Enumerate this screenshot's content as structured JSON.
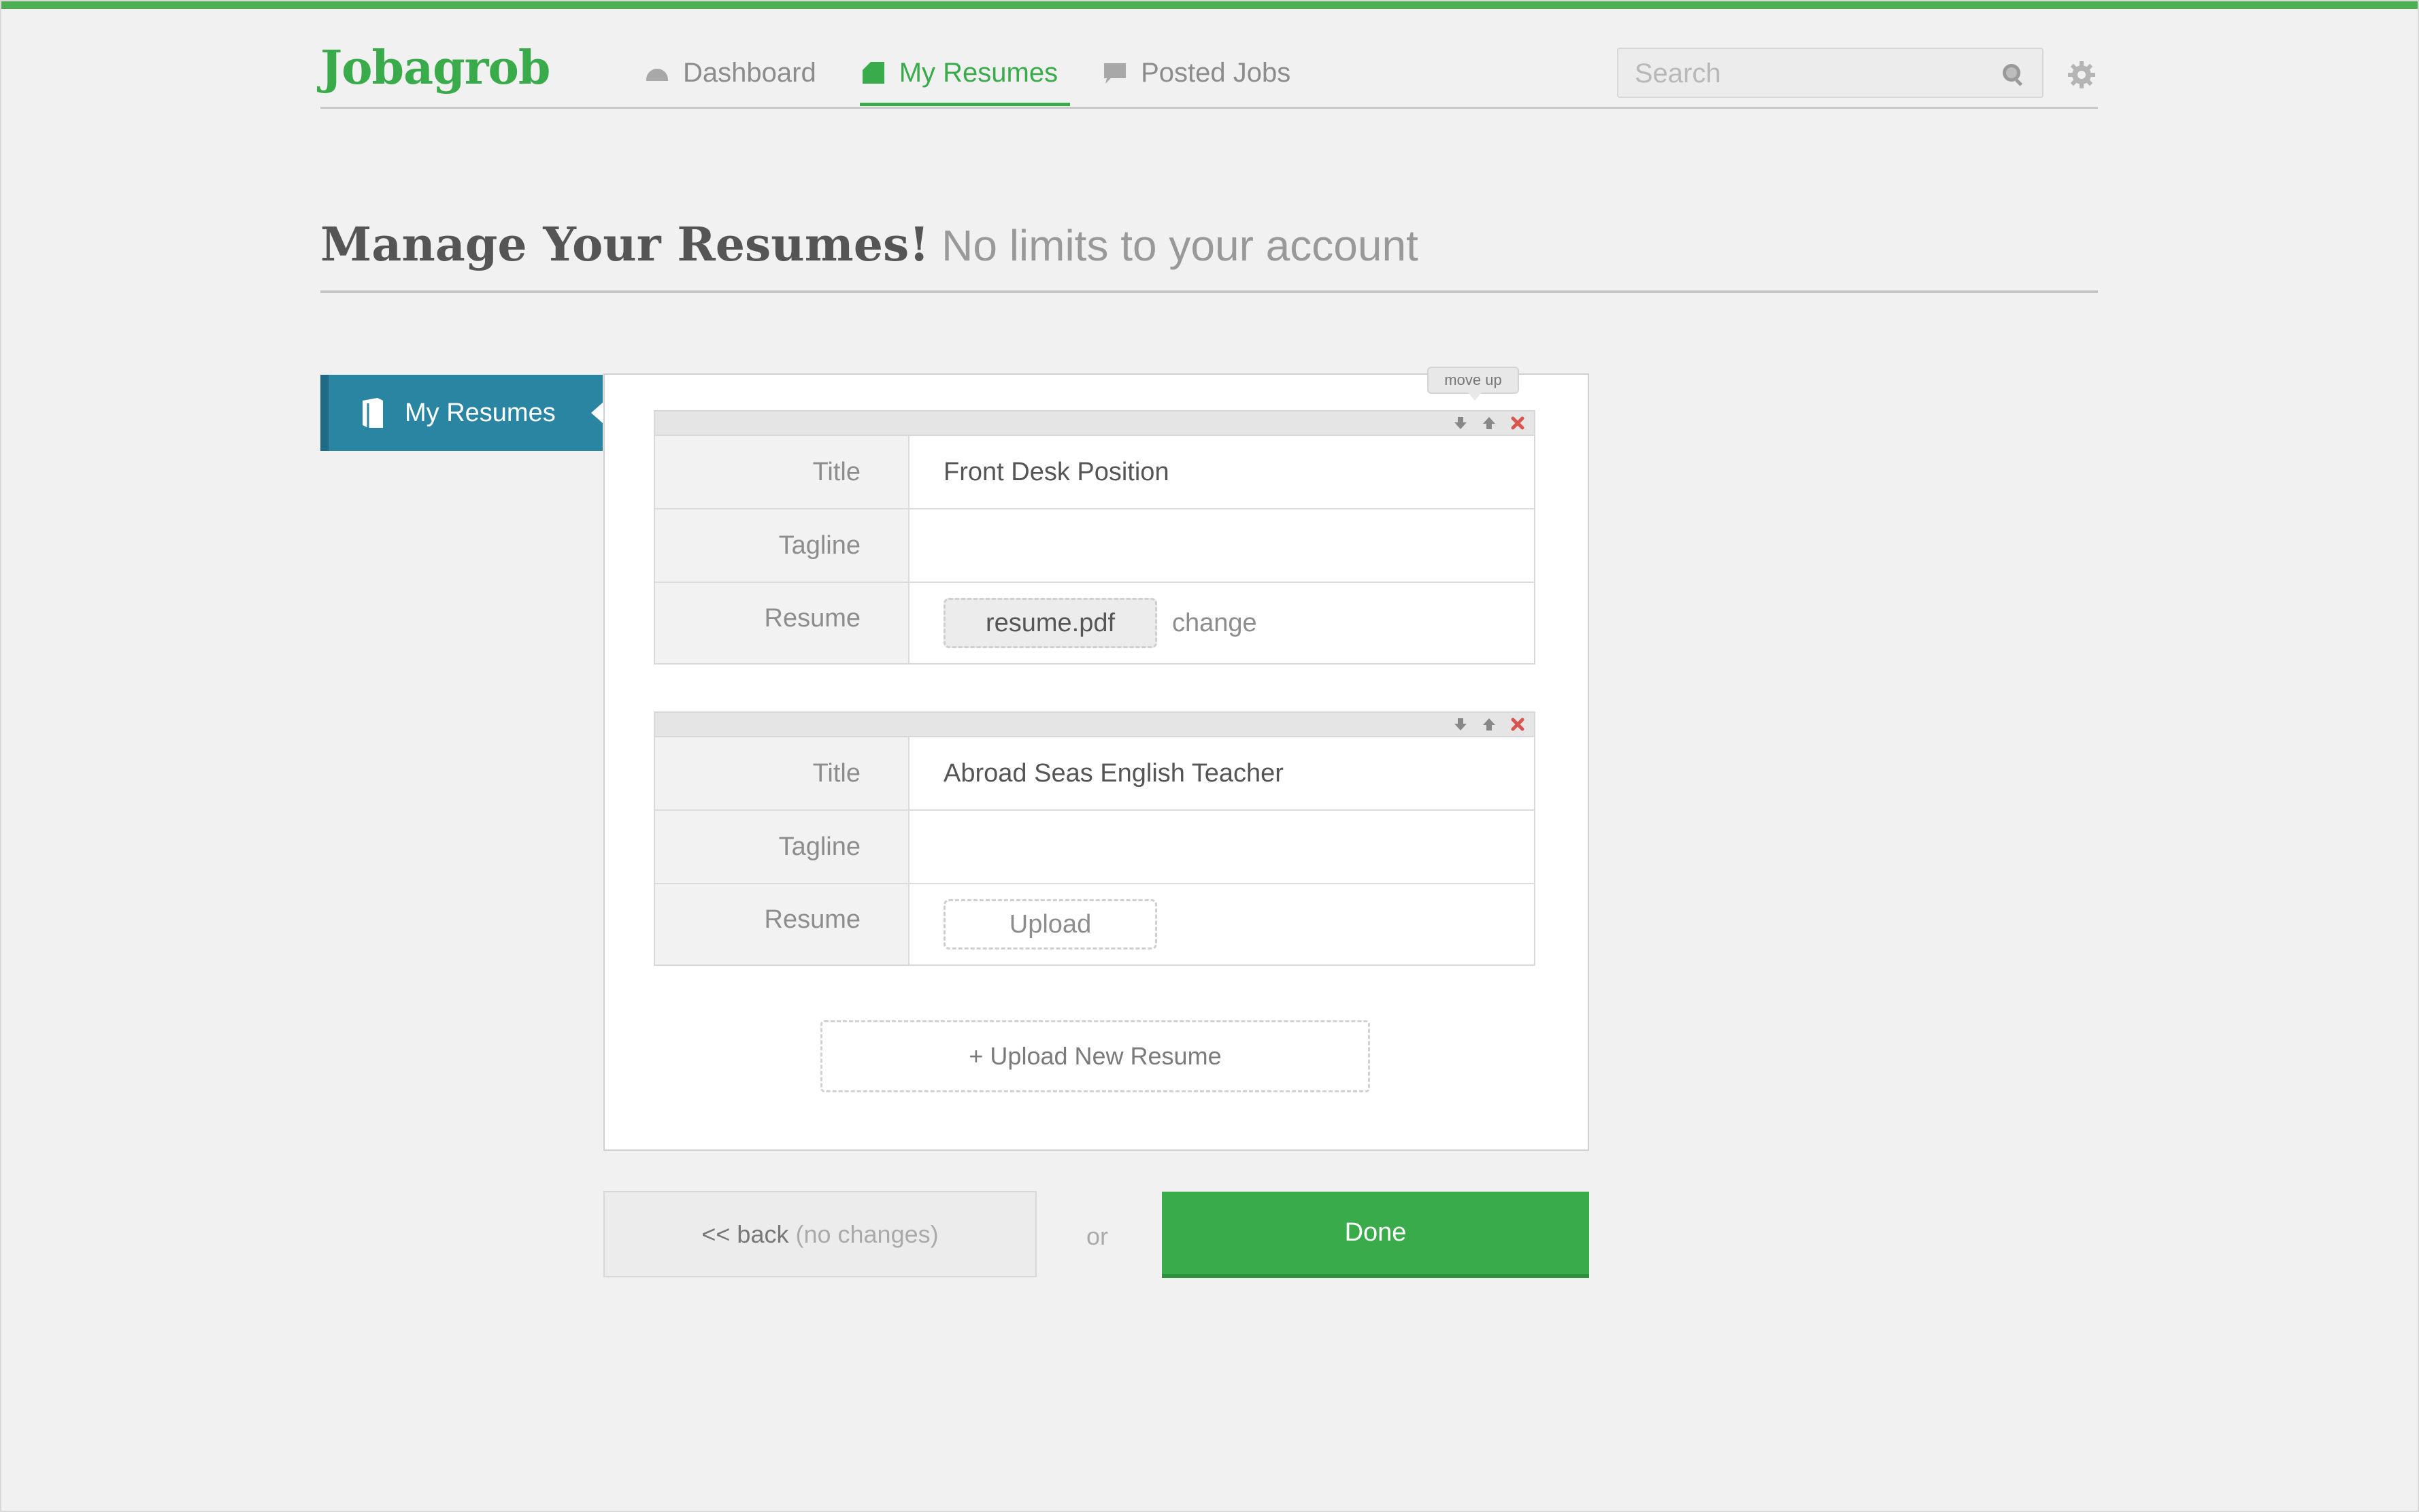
{
  "brand": {
    "logo": "Jobagrob"
  },
  "nav": {
    "items": [
      {
        "label": "Dashboard",
        "icon": "dashboard-icon",
        "active": false
      },
      {
        "label": "My Resumes",
        "icon": "resumes-icon",
        "active": true
      },
      {
        "label": "Posted Jobs",
        "icon": "chat-icon",
        "active": false
      }
    ]
  },
  "search": {
    "placeholder": "Search",
    "icon": "search-icon"
  },
  "settings": {
    "icon": "gear-icon"
  },
  "heading": {
    "main": "Manage Your Resumes!",
    "sub": "No limits to your account"
  },
  "sidetab": {
    "label": "My Resumes",
    "icon": "book-icon"
  },
  "tooltip": {
    "text": "move up"
  },
  "resumes": [
    {
      "fields": {
        "title_label": "Title",
        "tagline_label": "Tagline",
        "resume_label": "Resume"
      },
      "title": "Front Desk Position",
      "tagline": "",
      "file": "resume.pdf",
      "change_label": "change"
    },
    {
      "fields": {
        "title_label": "Title",
        "tagline_label": "Tagline",
        "resume_label": "Resume"
      },
      "title": "Abroad Seas English Teacher",
      "tagline": "",
      "file": "Upload"
    }
  ],
  "upload_new": "+ Upload New Resume",
  "footer": {
    "back_label": "<< back",
    "back_hint": "(no changes)",
    "or": "or",
    "done_label": "Done"
  },
  "colors": {
    "accent": "#3aab4a",
    "sidetab": "#2a85a3",
    "delete": "#d9534f"
  }
}
